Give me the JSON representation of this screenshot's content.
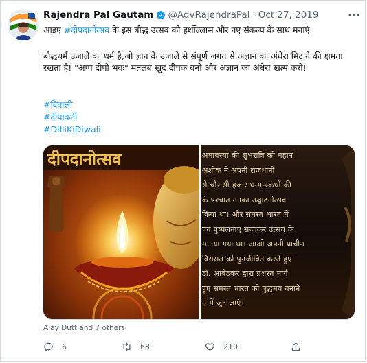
{
  "tweet": {
    "author_name": "Rajendra Pal Gautam",
    "handle": "@AdvRajendraPal",
    "date_separator": "·",
    "date": "Oct 27, 2019",
    "line1_pre": "आइए ",
    "line1_tag": "#दीपदानोत्सव",
    "line1_post": " के इस बौद्ध उत्सव को हर्शोल्लास और नए संकल्प के साथ मनाएं",
    "paragraph2": "बौद्धधर्म उजाले का धर्म है,जो ज्ञान के उजाले से संपूर्ण जगत से अज्ञान का अंधेरा मिटाने की क्षमता रखता है! \"अप्प दीपो भवः\" मतलब खुद दीपक बनो और अज्ञान का अंधेरा खत्म करो!",
    "hashtags": [
      "#दिवाली",
      "#दीपावली",
      "#DilliKiDiwali"
    ],
    "tagged_people": "Ajay Dutt and 7 others"
  },
  "media": {
    "left_image_banner": "दीपदानोत्सव",
    "right_image_lines": [
      "अमावस्या की शुभरात्रि को महान",
      "अशोक ने अपनी राजधानी",
      "से चौरासी हजार धम्म-स्कंधों की",
      "के पश्चात उनका उद्घाटनोत्सव",
      "किया था। और समस्त भारत में",
      "एवं पुष्पलताएं सजाकर उत्सव के",
      "मनाया गया था। आओ अपनी प्राचीन",
      "विरासत को पुनर्जीवित करते हुए",
      "डॉ. आंबेडकर द्वारा प्रशस्त मार्ग",
      "हुए समस्त भारत को बुद्धमय बनाने",
      "न में जुट जाएं।"
    ]
  },
  "actions": {
    "reply_count": "6",
    "retweet_count": "68",
    "like_count": "210"
  },
  "colors": {
    "accent": "#1d9bf0",
    "text": "#0f1419",
    "muted": "#536471"
  }
}
